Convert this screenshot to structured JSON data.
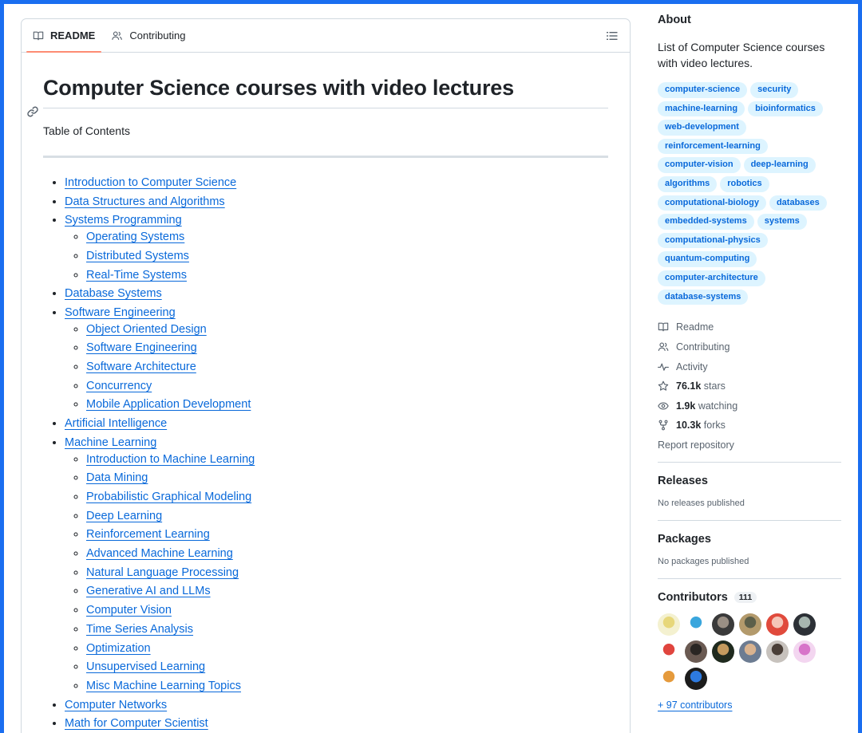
{
  "readme": {
    "tabs": [
      {
        "label": "README",
        "icon": "book-icon"
      },
      {
        "label": "Contributing",
        "icon": "people-icon"
      }
    ],
    "title": "Computer Science courses with video lectures",
    "toc_title": "Table of Contents",
    "toc": [
      {
        "label": "Introduction to Computer Science"
      },
      {
        "label": "Data Structures and Algorithms"
      },
      {
        "label": "Systems Programming",
        "children": [
          "Operating Systems",
          "Distributed Systems",
          "Real-Time Systems"
        ]
      },
      {
        "label": "Database Systems"
      },
      {
        "label": "Software Engineering",
        "children": [
          "Object Oriented Design",
          "Software Engineering",
          "Software Architecture",
          "Concurrency",
          "Mobile Application Development"
        ]
      },
      {
        "label": "Artificial Intelligence"
      },
      {
        "label": "Machine Learning",
        "children": [
          "Introduction to Machine Learning",
          "Data Mining",
          "Probabilistic Graphical Modeling",
          "Deep Learning",
          "Reinforcement Learning",
          "Advanced Machine Learning",
          "Natural Language Processing",
          "Generative AI and LLMs",
          "Computer Vision",
          "Time Series Analysis",
          "Optimization",
          "Unsupervised Learning",
          "Misc Machine Learning Topics"
        ]
      },
      {
        "label": "Computer Networks"
      },
      {
        "label": "Math for Computer Scientist"
      }
    ]
  },
  "about": {
    "heading": "About",
    "description": "List of Computer Science courses with video lectures.",
    "topics": [
      "computer-science",
      "security",
      "machine-learning",
      "bioinformatics",
      "web-development",
      "reinforcement-learning",
      "computer-vision",
      "deep-learning",
      "algorithms",
      "robotics",
      "computational-biology",
      "databases",
      "embedded-systems",
      "systems",
      "computational-physics",
      "quantum-computing",
      "computer-architecture",
      "database-systems"
    ],
    "links": {
      "readme": "Readme",
      "contributing": "Contributing",
      "activity": "Activity",
      "stars_count": "76.1k",
      "stars_label": "stars",
      "watching_count": "1.9k",
      "watching_label": "watching",
      "forks_count": "10.3k",
      "forks_label": "forks",
      "report": "Report repository"
    }
  },
  "releases": {
    "heading": "Releases",
    "empty": "No releases published"
  },
  "packages": {
    "heading": "Packages",
    "empty": "No packages published"
  },
  "contributors": {
    "heading": "Contributors",
    "count": "111",
    "more": "+ 97 contributors",
    "avatars": [
      {
        "colors": [
          "#f4f1d0",
          "#e7d77a"
        ]
      },
      {
        "colors": [
          "#ffffff",
          "#3aa6dd"
        ]
      },
      {
        "colors": [
          "#3a3a3a",
          "#9a8f84"
        ]
      },
      {
        "colors": [
          "#b39a6c",
          "#5c5f4a"
        ]
      },
      {
        "colors": [
          "#e04a3c",
          "#f5c6b8"
        ]
      },
      {
        "colors": [
          "#2c3036",
          "#a7b6b0"
        ]
      },
      {
        "colors": [
          "#ffffff",
          "#e0453e"
        ]
      },
      {
        "colors": [
          "#6a5a52",
          "#2a2623"
        ]
      },
      {
        "colors": [
          "#1f2a1e",
          "#c49a5e"
        ]
      },
      {
        "colors": [
          "#6c7c92",
          "#d9b38f"
        ]
      },
      {
        "colors": [
          "#c7c2bd",
          "#4a3f38"
        ]
      },
      {
        "colors": [
          "#f3d6f0",
          "#d774c9"
        ]
      },
      {
        "colors": [
          "#ffffff",
          "#e59a3c"
        ]
      },
      {
        "colors": [
          "#1c1c1c",
          "#2d7ae0"
        ]
      }
    ]
  }
}
